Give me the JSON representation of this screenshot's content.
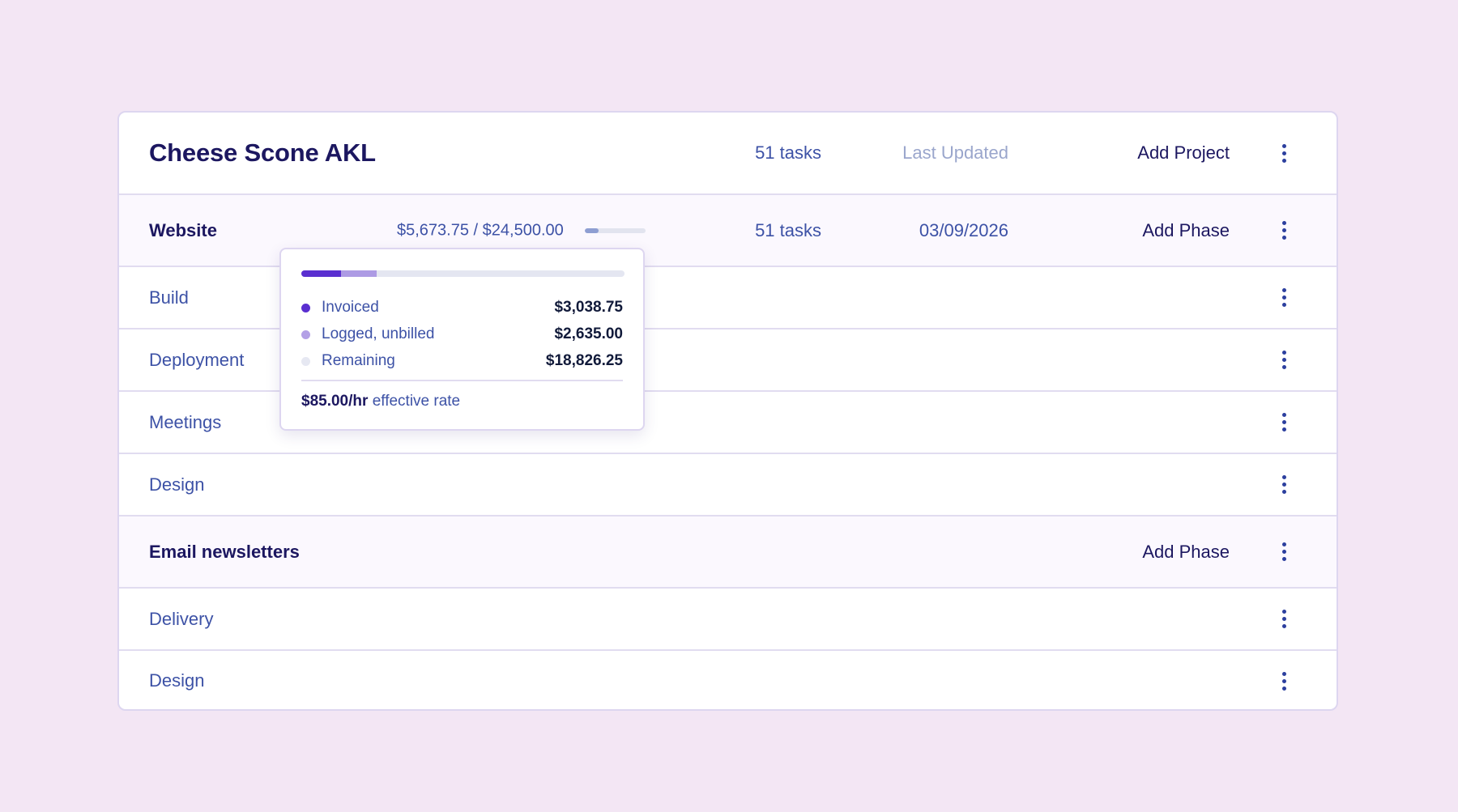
{
  "project": {
    "title": "Cheese Scone AKL",
    "tasks": "51 tasks",
    "last_updated_label": "Last Updated",
    "add_label": "Add Project"
  },
  "phases": [
    {
      "name": "Website",
      "budget_text": "$5,673.75 / $24,500.00",
      "budget_progress_pct": 23,
      "tasks": "51 tasks",
      "date": "03/09/2026",
      "add_label": "Add Phase",
      "subphases": [
        "Build",
        "Deployment",
        "Meetings",
        "Design"
      ]
    },
    {
      "name": "Email newsletters",
      "add_label": "Add Phase",
      "subphases": [
        "Delivery",
        "Design"
      ]
    }
  ],
  "tooltip": {
    "segments_pct": [
      12.4,
      10.8
    ],
    "rows": [
      {
        "label": "Invoiced",
        "value": "$3,038.75",
        "color": "#5a2fd0"
      },
      {
        "label": "Logged, unbilled",
        "value": "$2,635.00",
        "color": "#b3a0e6"
      },
      {
        "label": "Remaining",
        "value": "$18,826.25",
        "color": "#e6e8f2"
      }
    ],
    "rate_value": "$85.00/hr",
    "rate_label": "effective rate"
  },
  "colors": {
    "background": "#f3e6f4",
    "title": "#1c1760",
    "link": "#3d52a6",
    "muted": "#9aa6cc",
    "invoiced": "#5a2fd0",
    "logged": "#b3a0e6"
  }
}
